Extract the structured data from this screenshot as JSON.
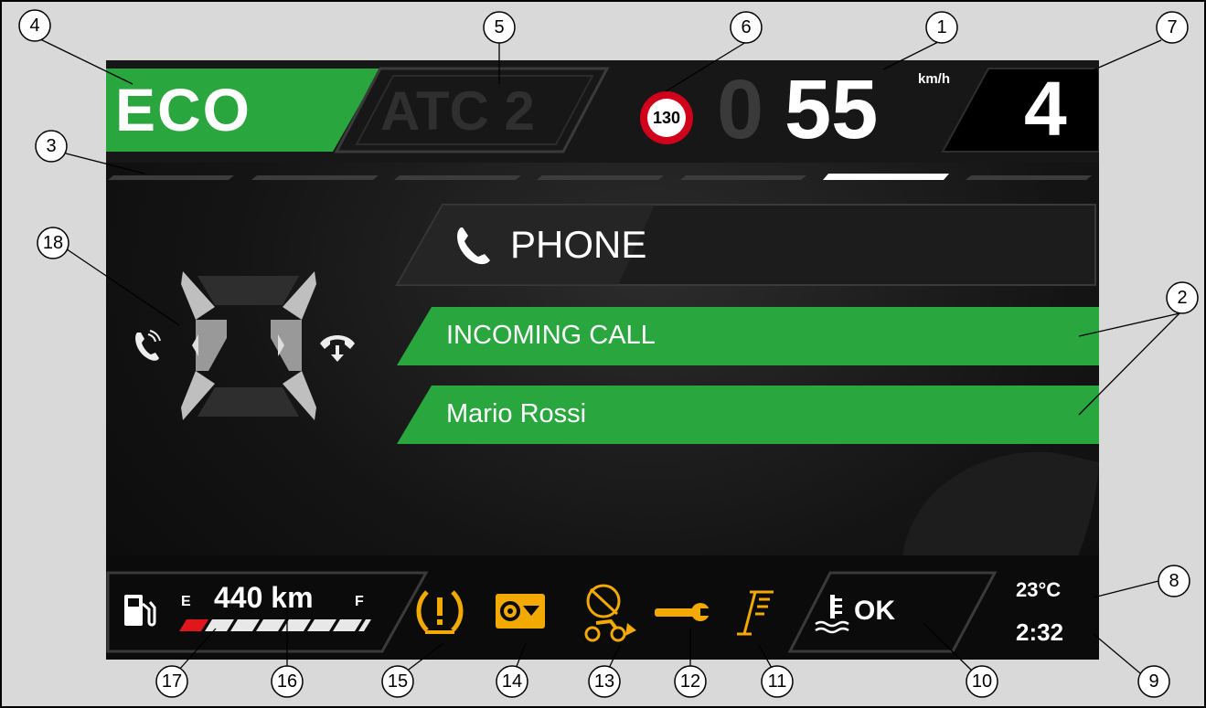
{
  "header": {
    "mode": "ECO",
    "traction": "ATC 2",
    "speed_limit": "130",
    "speed_ghost": "0",
    "speed": "55",
    "speed_unit": "km/h",
    "gear": "4"
  },
  "menu": {
    "title": "PHONE",
    "row1": "INCOMING CALL",
    "row2": "Mario Rossi"
  },
  "footer": {
    "fuel_e": "E",
    "fuel_f": "F",
    "range": "440 km",
    "fuel_level": 0.15,
    "coolant_status": "OK",
    "temperature": "23°C",
    "clock": "2:32"
  },
  "callouts": [
    "1",
    "2",
    "2",
    "3",
    "4",
    "5",
    "6",
    "7",
    "8",
    "9",
    "10",
    "11",
    "12",
    "13",
    "14",
    "15",
    "16",
    "17",
    "18"
  ],
  "colors": {
    "accent_green": "#2aa63f",
    "warning_amber": "#f2a900",
    "speed_limit_red": "#d0021b",
    "fuel_red": "#e0161b"
  },
  "icons": [
    "phone-icon",
    "call-answer-icon",
    "call-hangup-icon",
    "fuel-pump-icon",
    "tire-pressure-icon",
    "service-icon",
    "abs-off-icon",
    "wrench-icon",
    "side-stand-icon",
    "coolant-icon"
  ]
}
